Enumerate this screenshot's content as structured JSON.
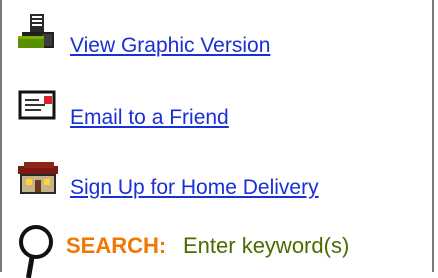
{
  "links": [
    {
      "label": "View Graphic Version",
      "icon": "printer-icon"
    },
    {
      "label": "Email to a Friend",
      "icon": "email-card-icon"
    },
    {
      "label": "Sign Up for Home Delivery",
      "icon": "house-icon"
    }
  ],
  "search": {
    "label": "SEARCH:",
    "placeholder": "Enter keyword(s)",
    "value": ""
  },
  "colors": {
    "link": "#1a2fd6",
    "search_label": "#f07800",
    "search_text": "#4b6b00",
    "border": "#7a7a7a"
  }
}
